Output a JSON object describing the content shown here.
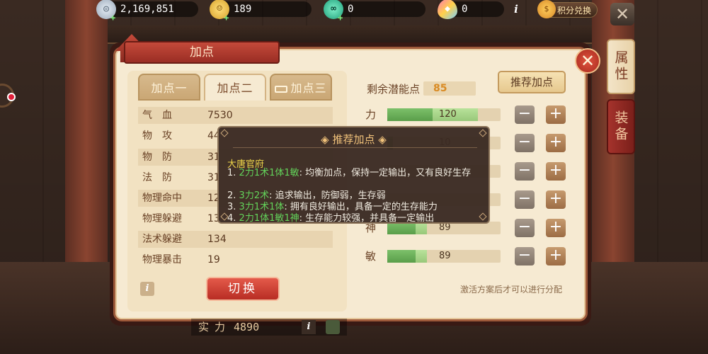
{
  "currencies": {
    "silver": {
      "value": "2,169,851",
      "icon": "silver-coin-icon"
    },
    "gold": {
      "value": "189",
      "icon": "gold-coin-icon"
    },
    "jade": {
      "value": "0",
      "icon": "jade-icon"
    },
    "gem": {
      "value": "0",
      "icon": "gem-icon"
    },
    "exchange_label": "积分兑换"
  },
  "side_tabs": [
    {
      "label": "属性",
      "active": true
    },
    {
      "label": "装备",
      "active": false
    }
  ],
  "panel": {
    "title": "加点",
    "tabs": [
      {
        "label": "加点一",
        "active": false
      },
      {
        "label": "加点二",
        "active": true
      },
      {
        "label": "加点三",
        "active": false
      }
    ],
    "stats": [
      {
        "label": "气　血",
        "value": "7530"
      },
      {
        "label": "物　攻",
        "value": "44"
      },
      {
        "label": "物　防",
        "value": "31"
      },
      {
        "label": "法　防",
        "value": "31"
      },
      {
        "label": "物理命中",
        "value": "12"
      },
      {
        "label": "物理躲避",
        "value": "13"
      },
      {
        "label": "法术躲避",
        "value": "134"
      },
      {
        "label": "物理暴击",
        "value": "19"
      }
    ],
    "switch_label": "切换",
    "remaining_label": "剩余潜能点",
    "remaining_value": "85",
    "recommend_label": "推荐加点",
    "attributes": [
      {
        "label": "力",
        "value": "120",
        "fill": 0.4,
        "bonus": 0.4
      },
      {
        "label": "",
        "value": "10",
        "fill": 0.05,
        "bonus": 0
      },
      {
        "label": "",
        "value": "",
        "fill": 0.0,
        "bonus": 0
      },
      {
        "label": "",
        "value": "",
        "fill": 0.0,
        "bonus": 0
      },
      {
        "label": "神",
        "value": "89",
        "fill": 0.25,
        "bonus": 0.1
      },
      {
        "label": "敏",
        "value": "89",
        "fill": 0.25,
        "bonus": 0.1
      }
    ],
    "activate_note": "激活方案后才可以进行分配"
  },
  "strength": {
    "label": "实力",
    "value": "4890"
  },
  "tooltip": {
    "title": "推荐加点",
    "faction": "大唐官府",
    "lines": [
      {
        "num": "1.",
        "hl": "2力1术1体1敏",
        "text": ": 均衡加点，保持一定输出，又有良好生存"
      },
      {
        "num": "2.",
        "hl": "3力2术",
        "text": ": 追求输出，防御弱，生存弱"
      },
      {
        "num": "3.",
        "hl": "3力1术1体",
        "text": ": 拥有良好输出，具备一定的生存能力"
      },
      {
        "num": "4.",
        "hl": "2力1体1敏1神",
        "text": ": 生存能力较强，并具备一定输出"
      }
    ]
  },
  "colors": {
    "accent_red": "#b82d24",
    "panel_bg": "#f6ead2",
    "highlight_green": "#63d35a",
    "faction_yellow": "#f0d64a",
    "remaining_orange": "#d98a22"
  }
}
